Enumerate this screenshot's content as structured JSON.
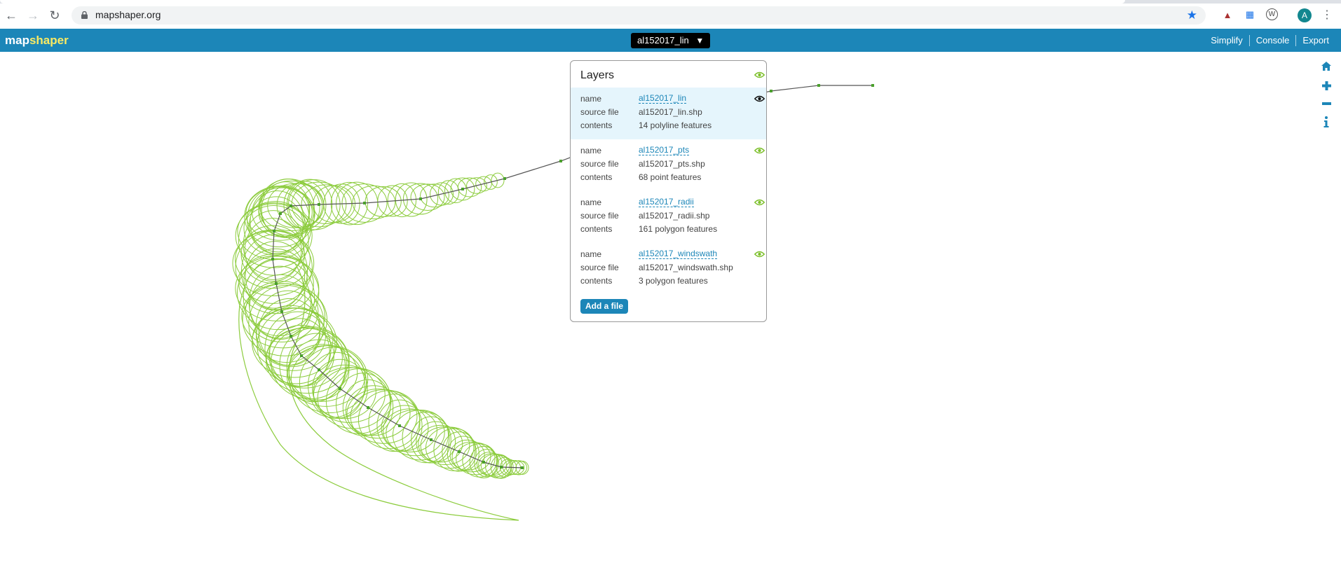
{
  "browser": {
    "url": "mapshaper.org",
    "avatar_initial": "A"
  },
  "app": {
    "logo_part1": "map",
    "logo_part2": "shaper",
    "selected_layer": "al152017_lin",
    "dropdown_arrow": "▼",
    "menu": {
      "simplify": "Simplify",
      "console": "Console",
      "export": "Export"
    }
  },
  "layers_panel": {
    "title": "Layers",
    "labels": {
      "name": "name",
      "source": "source file",
      "contents": "contents"
    },
    "layers": [
      {
        "name": "al152017_lin",
        "source_file": "al152017_lin.shp",
        "contents": "14 polyline features",
        "active": true
      },
      {
        "name": "al152017_pts",
        "source_file": "al152017_pts.shp",
        "contents": "68 point features",
        "active": false
      },
      {
        "name": "al152017_radii",
        "source_file": "al152017_radii.shp",
        "contents": "161 polygon features",
        "active": false
      },
      {
        "name": "al152017_windswath",
        "source_file": "al152017_windswath.shp",
        "contents": "3 polygon features",
        "active": false
      }
    ],
    "add_button": "Add a file"
  },
  "colors": {
    "accent": "#1c86b8",
    "polygon_stroke": "#8ccc3d",
    "track_line": "#555555",
    "track_point": "#4aa02c",
    "eye_green": "#7cbf2a"
  }
}
